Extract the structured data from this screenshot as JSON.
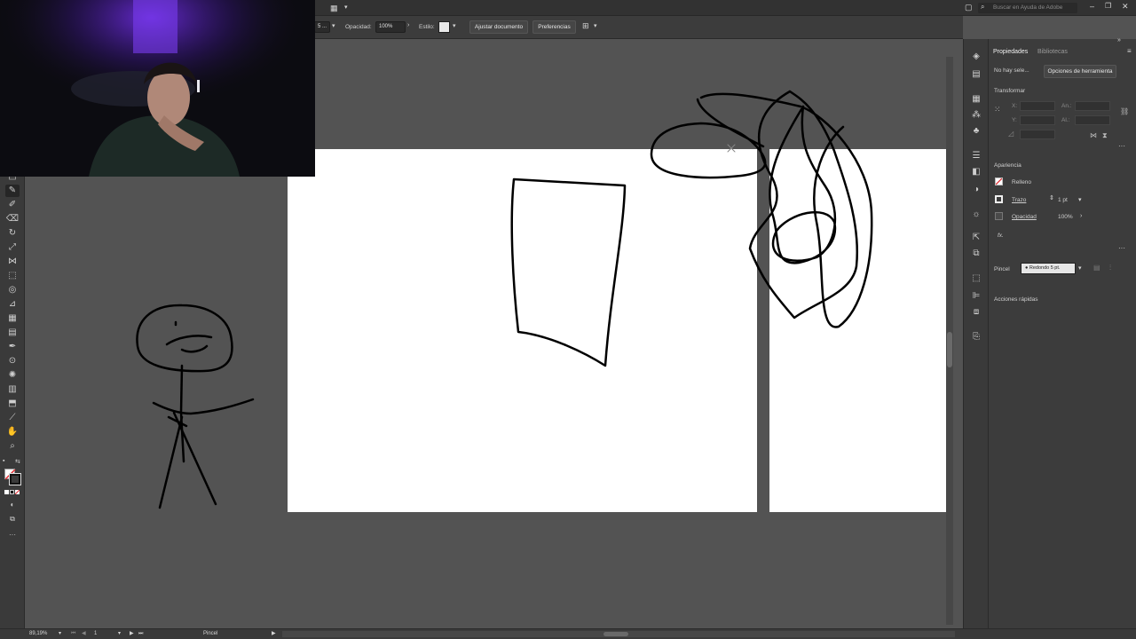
{
  "topbar": {
    "search_placeholder": "Buscar en Ayuda de Adobe"
  },
  "control_bar": {
    "stroke_value": "5 ...",
    "opacity_label": "Opacidad:",
    "opacity_value": "100%",
    "style_label": "Estilo:",
    "fit_document_label": "Ajustar documento",
    "preferences_label": "Preferencias"
  },
  "properties_panel": {
    "tabs": [
      "Propiedades",
      "Bibliotecas"
    ],
    "no_selection_label": "No hay sele...",
    "tool_options_button": "Opciones de herramienta",
    "transform_title": "Transformar",
    "transform_fields": {
      "x_label": "X:",
      "y_label": "Y:",
      "width_label": "An.:",
      "height_label": "Al.:"
    },
    "appearance_title": "Apariencia",
    "fill_label": "Relleno",
    "stroke_label": "Trazo",
    "stroke_weight": "1 pt",
    "opacity_label": "Opacidad",
    "opacity_value": "100%",
    "fx_label": "fx.",
    "brush_label": "Pincel",
    "brush_value": "Redondo 5 pt.",
    "quick_actions_title": "Acciones rápidas"
  },
  "status_bar": {
    "zoom": "89,19%",
    "artboard_number": "1",
    "current_tool": "Pincel"
  },
  "colors": {
    "workspace_bg": "#535353",
    "panel_bg": "#3c3c3c",
    "artboard": "#ffffff"
  }
}
